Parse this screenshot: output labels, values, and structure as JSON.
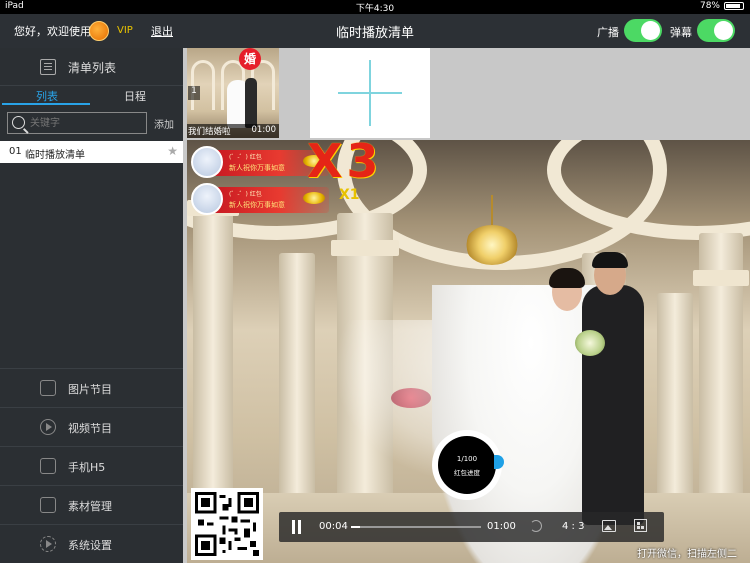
{
  "status_bar": {
    "device": "iPad",
    "time": "下午4:30",
    "battery": "78%",
    "battery_level": 0.78
  },
  "header": {
    "greeting": "您好，欢迎使用",
    "vip": "VIP",
    "logout": "退出",
    "title": "临时播放清单",
    "toggle_broadcast": {
      "label": "广播",
      "on": true
    },
    "toggle_danmaku": {
      "label": "弹幕",
      "on": true
    },
    "accent": "#4cd964"
  },
  "sidebar": {
    "header": "清单列表",
    "tabs": [
      {
        "label": "列表",
        "active": true
      },
      {
        "label": "日程",
        "active": false
      }
    ],
    "search_placeholder": "关键字",
    "add_label": "添加",
    "playlist": [
      {
        "num": "01",
        "name": "临时播放清单"
      }
    ],
    "menu": [
      {
        "label": "图片节目",
        "icon": "image-icon"
      },
      {
        "label": "视频节目",
        "icon": "video-icon"
      },
      {
        "label": "手机H5",
        "icon": "edit-icon"
      },
      {
        "label": "素材管理",
        "icon": "folder-icon"
      },
      {
        "label": "系统设置",
        "icon": "gear-icon"
      }
    ],
    "accent": "#29a3e8"
  },
  "thumbnails": [
    {
      "index": "1",
      "badge": "婚",
      "title": "我们结婚啦",
      "duration": "01:00"
    }
  ],
  "danmaku": [
    {
      "user": "(゜-゜) 红包",
      "message": "新人祝你万事如意"
    },
    {
      "user": "(゜-゜) 红包",
      "message": "新人祝你万事如意"
    }
  ],
  "multipliers": {
    "big": "X3",
    "small": "X1"
  },
  "redpacket": {
    "progress": "1/100",
    "label": "红包进度"
  },
  "player": {
    "current": "00:04",
    "total": "01:00",
    "ratio": "4 : 3",
    "played_fraction": 0.067
  },
  "ticker": "打开微信，扫描左侧二"
}
